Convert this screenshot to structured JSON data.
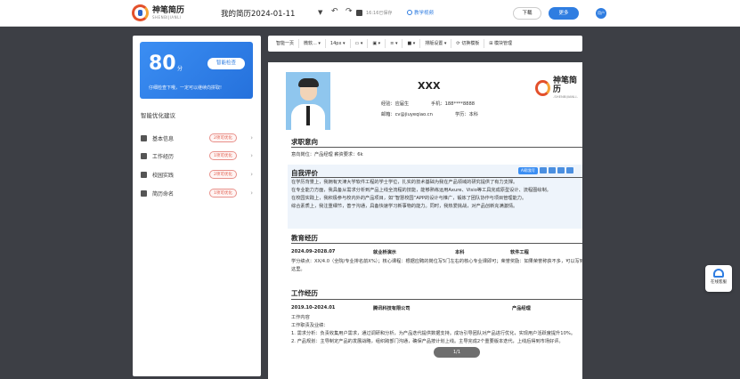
{
  "header": {
    "logo_cn": "神笔简历",
    "logo_en": "SHENBIJIANLI",
    "doc_title": "我的简历2024-01-11",
    "save_status": "16:16已保存",
    "tutorial": "教学视频",
    "download_label": "下载",
    "more_label": "更多",
    "avatar_text": "用户"
  },
  "score_card": {
    "score": "80",
    "unit": "分",
    "button": "智能检查",
    "tip": "仔细检查下哦，一定可以继续向拼取!"
  },
  "optimize": {
    "title": "智能优化建议",
    "items": [
      {
        "label": "基本信息",
        "badge": "2项可优化"
      },
      {
        "label": "工作经历",
        "badge": "1项可优化"
      },
      {
        "label": "校园实践",
        "badge": "2项可优化"
      },
      {
        "label": "简历命名",
        "badge": "1项可优化"
      }
    ]
  },
  "toolbar": {
    "items": [
      "智能一页",
      "微软...",
      "14px",
      "",
      "",
      "",
      "",
      "排版设置",
      "切换模板",
      "模块管理"
    ]
  },
  "resume": {
    "name": "XXX",
    "experience_label": "经验：",
    "experience": "应届生",
    "phone_label": "手机：",
    "phone": "188****8888",
    "email_label": "邮箱：",
    "email": "cv@jiuyeqiao.cn",
    "degree_label": "学历：",
    "degree": "本科",
    "brand_cn": "神笔简历",
    "brand_en": "-SHENBIJIANLI-",
    "intent_title": "求职意向",
    "intent_line": "意向岗位：产品经理        薪资要求：6k",
    "self_title": "自我评价",
    "ai_tag": "AI帮我写",
    "self_lines": [
      "在学历背景上，我拥有天津大学软件工程的学士学位，扎实的技术基础为我在产品领域的研究提供了有力支撑。",
      "在专业能力方面，我具备从需求分析到产品上线全流程的技能，能够熟练运用Axure、Visio等工具完成原型设计、流程图绘制。",
      "在校园实践上，我积极参与校内外的产品项目，如“智慧校园”APP的设计与推广，锻炼了团队协作与项目管理能力。",
      "综合素质上，我注重细节，善于沟通，具备快速学习新事物的能力。同时，我热爱挑战，对产品创新充满激情。"
    ],
    "edu_title": "教育经历",
    "edu_period": "2024.09-2028.07",
    "edu_school": "就业桥演示",
    "edu_degree": "本科",
    "edu_major": "软件工程",
    "edu_lines": [
      "学分绩点：XX/4.0（全院/专业排名前X%）；核心课程：根据应聘的岗位写5门左右的核心专业课即可；荣誉奖励：如果荣誉称获不多，可以写到这里。"
    ],
    "work_title": "工作经历",
    "work_period": "2019.10-2024.01",
    "work_company": "腾讯科技有限公司",
    "work_role": "产品经理",
    "work_lines": [
      "工作内容",
      "工作职责及业绩：",
      "1. 需求分析：负责收集用户需求，通过调研和分析，为产品迭代提供数据支持。成功引导团队对产品进行优化，实现用户活跃度提升10%。",
      "2. 产品规划：主导制定产品的发展战略，组织跨部门沟通，确保产品按计划上线。主导完成2个重要版本迭代，上线后得到市场好评。"
    ],
    "pager": "1/1"
  },
  "float": {
    "service": "在线客服"
  }
}
